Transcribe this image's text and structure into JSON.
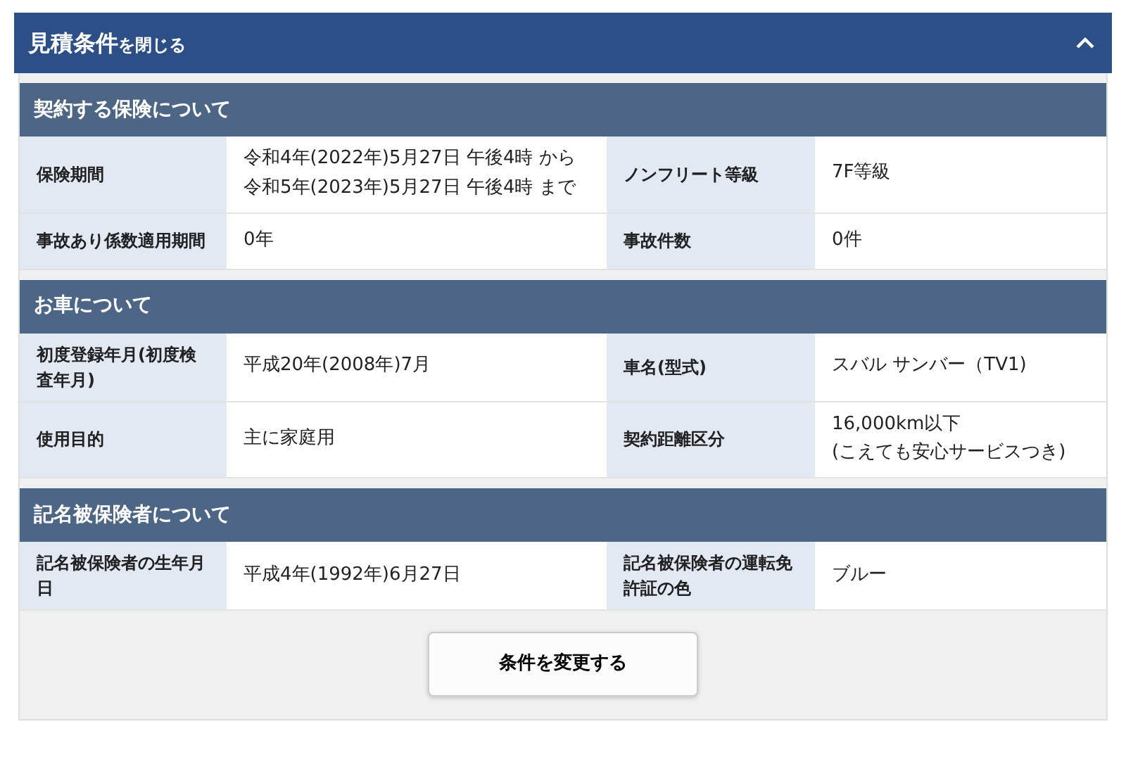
{
  "panel": {
    "title": "見積条件",
    "title_suffix": "を閉じる",
    "expanded": true
  },
  "sections": [
    {
      "title": "契約する保険について",
      "rows": [
        [
          {
            "label": "保険期間",
            "value": [
              "令和4年(2022年)5月27日 午後4時 から",
              "令和5年(2023年)5月27日 午後4時 まで"
            ]
          },
          {
            "label": "ノンフリート等級",
            "value": [
              "7F等級"
            ]
          }
        ],
        [
          {
            "label": "事故あり係数適用期間",
            "value": [
              "0年"
            ]
          },
          {
            "label": "事故件数",
            "value": [
              "0件"
            ]
          }
        ]
      ]
    },
    {
      "title": "お車について",
      "rows": [
        [
          {
            "label": "初度登録年月(初度検査年月)",
            "value": [
              "平成20年(2008年)7月"
            ]
          },
          {
            "label": "車名(型式)",
            "value": [
              "スバル サンバー（TV1)"
            ]
          }
        ],
        [
          {
            "label": "使用目的",
            "value": [
              "主に家庭用"
            ]
          },
          {
            "label": "契約距離区分",
            "value": [
              "16,000km以下",
              "(こえても安心サービスつき)"
            ]
          }
        ]
      ]
    },
    {
      "title": "記名被保険者について",
      "rows": [
        [
          {
            "label": "記名被保険者の生年月日",
            "value": [
              "平成4年(1992年)6月27日"
            ]
          },
          {
            "label": "記名被保険者の運転免許証の色",
            "value": [
              "ブルー"
            ]
          }
        ]
      ]
    }
  ],
  "button": "条件を変更する"
}
